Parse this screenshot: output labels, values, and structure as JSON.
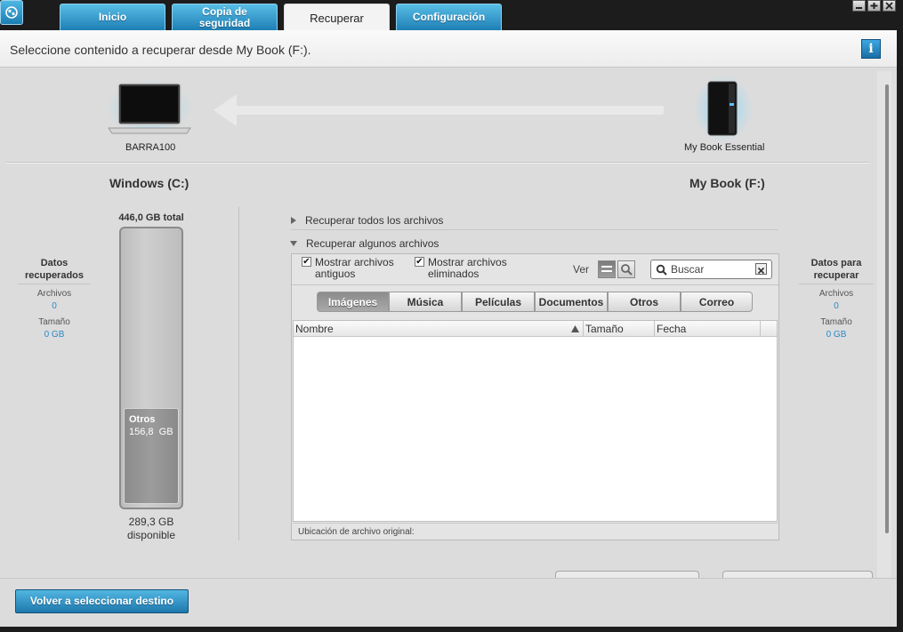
{
  "tabs": [
    {
      "label": "Inicio"
    },
    {
      "label": "Copia de seguridad"
    },
    {
      "label": "Recuperar"
    },
    {
      "label": "Configuración"
    }
  ],
  "header": {
    "title": "Seleccione contenido a recuperar desde My Book (F:)."
  },
  "devices": {
    "source_name": "BARRA100",
    "target_name": "My Book Essential"
  },
  "drives": {
    "left_title": "Windows (C:)",
    "right_title": "My Book (F:)"
  },
  "gauge": {
    "total": "446,0 GB total",
    "fill_label": "Otros",
    "fill_value": "156,8  GB",
    "free_value": "289,3 GB",
    "free_label": "disponible",
    "fill_fraction": 0.35
  },
  "left_stats": {
    "title": "Datos recuperados",
    "files_label": "Archivos",
    "files_value": "0",
    "size_label": "Tamaño",
    "size_value": "0 GB"
  },
  "right_stats": {
    "title": "Datos para recuperar",
    "files_label": "Archivos",
    "files_value": "0",
    "size_label": "Tamaño",
    "size_value": "0 GB"
  },
  "options": {
    "all_files": "Recuperar todos los archivos",
    "some_files": "Recuperar algunos archivos"
  },
  "filters": {
    "show_old": "Mostrar archivos antiguos",
    "show_deleted": "Mostrar archivos eliminados",
    "view_label": "Ver",
    "search_placeholder": "Buscar"
  },
  "categories": [
    {
      "label": "Imágenes"
    },
    {
      "label": "Música"
    },
    {
      "label": "Películas"
    },
    {
      "label": "Documentos"
    },
    {
      "label": "Otros"
    },
    {
      "label": "Correo"
    }
  ],
  "columns": {
    "name": "Nombre",
    "size": "Tamaño",
    "date": "Fecha"
  },
  "footer": {
    "original_location": "Ubicación de archivo original:"
  },
  "buttons": {
    "back": "Volver a seleccionar destino"
  },
  "colors": {
    "accent": "#2a8ac8",
    "tab_blue": "#1e7fb5"
  }
}
